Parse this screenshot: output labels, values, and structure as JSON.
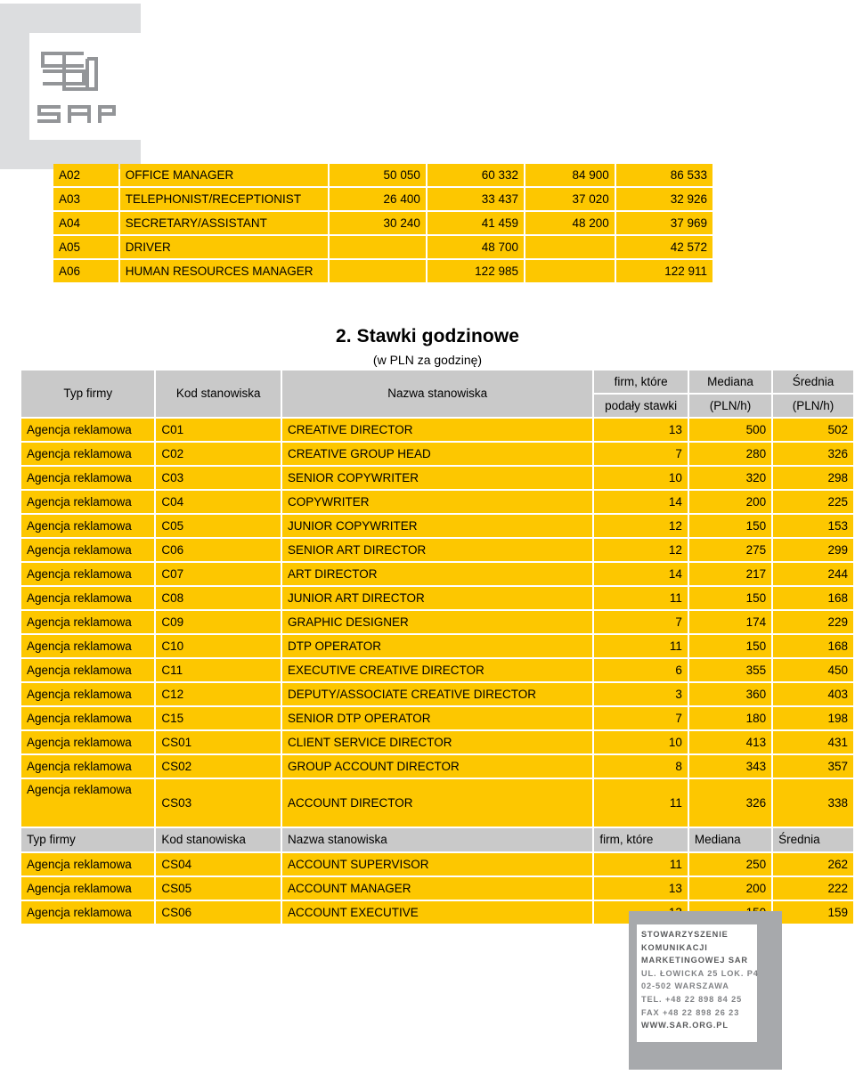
{
  "logo": {
    "brand": "SAR",
    "mark_name": "sar-logo-mark"
  },
  "top_table": {
    "rows": [
      {
        "code": "A02",
        "name": "OFFICE MANAGER",
        "v1": "50 050",
        "v2": "60 332",
        "v3": "84 900",
        "v4": "86 533"
      },
      {
        "code": "A03",
        "name": "TELEPHONIST/RECEPTIONIST",
        "v1": "26 400",
        "v2": "33 437",
        "v3": "37 020",
        "v4": "32 926"
      },
      {
        "code": "A04",
        "name": "SECRETARY/ASSISTANT",
        "v1": "30 240",
        "v2": "41 459",
        "v3": "48 200",
        "v4": "37 969"
      },
      {
        "code": "A05",
        "name": "DRIVER",
        "v1": "",
        "v2": "48 700",
        "v3": "",
        "v4": "42 572"
      },
      {
        "code": "A06",
        "name": "HUMAN RESOURCES MANAGER",
        "v1": "",
        "v2": "122 985",
        "v3": "",
        "v4": "122 911"
      }
    ]
  },
  "section": {
    "title": "2. Stawki godzinowe",
    "subtitle": "(w PLN za godzinę)"
  },
  "main_table": {
    "headers": {
      "typ": "Typ firmy",
      "kod": "Kod stanowiska",
      "nazwa": "Nazwa stanowiska",
      "firm_line1": "firm, które",
      "firm_line2": "podały stawki",
      "mediana_line1": "Mediana",
      "mediana_line2": "(PLN/h)",
      "srednia_line1": "Średnia",
      "srednia_line2": "(PLN/h)"
    },
    "headers_repeat": {
      "typ": "Typ firmy",
      "kod": "Kod stanowiska",
      "nazwa": "Nazwa stanowiska",
      "firm": "firm, które",
      "mediana": "Mediana",
      "srednia": "Średnia"
    },
    "rows": [
      {
        "typ": "Agencja reklamowa",
        "kod": "C01",
        "nazwa": "CREATIVE DIRECTOR",
        "firm": "13",
        "mediana": "500",
        "srednia": "502"
      },
      {
        "typ": "Agencja reklamowa",
        "kod": "C02",
        "nazwa": "CREATIVE GROUP HEAD",
        "firm": "7",
        "mediana": "280",
        "srednia": "326"
      },
      {
        "typ": "Agencja reklamowa",
        "kod": "C03",
        "nazwa": "SENIOR COPYWRITER",
        "firm": "10",
        "mediana": "320",
        "srednia": "298"
      },
      {
        "typ": "Agencja reklamowa",
        "kod": "C04",
        "nazwa": "COPYWRITER",
        "firm": "14",
        "mediana": "200",
        "srednia": "225"
      },
      {
        "typ": "Agencja reklamowa",
        "kod": "C05",
        "nazwa": "JUNIOR COPYWRITER",
        "firm": "12",
        "mediana": "150",
        "srednia": "153"
      },
      {
        "typ": "Agencja reklamowa",
        "kod": "C06",
        "nazwa": "SENIOR ART DIRECTOR",
        "firm": "12",
        "mediana": "275",
        "srednia": "299"
      },
      {
        "typ": "Agencja reklamowa",
        "kod": "C07",
        "nazwa": "ART DIRECTOR",
        "firm": "14",
        "mediana": "217",
        "srednia": "244"
      },
      {
        "typ": "Agencja reklamowa",
        "kod": "C08",
        "nazwa": "JUNIOR ART DIRECTOR",
        "firm": "11",
        "mediana": "150",
        "srednia": "168"
      },
      {
        "typ": "Agencja reklamowa",
        "kod": "C09",
        "nazwa": "GRAPHIC DESIGNER",
        "firm": "7",
        "mediana": "174",
        "srednia": "229"
      },
      {
        "typ": "Agencja reklamowa",
        "kod": "C10",
        "nazwa": "DTP OPERATOR",
        "firm": "11",
        "mediana": "150",
        "srednia": "168"
      },
      {
        "typ": "Agencja reklamowa",
        "kod": "C11",
        "nazwa": "EXECUTIVE CREATIVE DIRECTOR",
        "firm": "6",
        "mediana": "355",
        "srednia": "450"
      },
      {
        "typ": "Agencja reklamowa",
        "kod": "C12",
        "nazwa": "DEPUTY/ASSOCIATE CREATIVE DIRECTOR",
        "firm": "3",
        "mediana": "360",
        "srednia": "403"
      },
      {
        "typ": "Agencja reklamowa",
        "kod": "C15",
        "nazwa": "SENIOR DTP OPERATOR",
        "firm": "7",
        "mediana": "180",
        "srednia": "198"
      },
      {
        "typ": "Agencja reklamowa",
        "kod": "CS01",
        "nazwa": "CLIENT SERVICE DIRECTOR",
        "firm": "10",
        "mediana": "413",
        "srednia": "431"
      },
      {
        "typ": "Agencja reklamowa",
        "kod": "CS02",
        "nazwa": "GROUP ACCOUNT DIRECTOR",
        "firm": "8",
        "mediana": "343",
        "srednia": "357"
      },
      {
        "typ": "Agencja reklamowa",
        "kod": "CS03",
        "nazwa": "ACCOUNT DIRECTOR",
        "firm": "11",
        "mediana": "326",
        "srednia": "338",
        "tall": true
      }
    ],
    "rows_after_repeat": [
      {
        "typ": "Agencja reklamowa",
        "kod": "CS04",
        "nazwa": "ACCOUNT SUPERVISOR",
        "firm": "11",
        "mediana": "250",
        "srednia": "262"
      },
      {
        "typ": "Agencja reklamowa",
        "kod": "CS05",
        "nazwa": "ACCOUNT MANAGER",
        "firm": "13",
        "mediana": "200",
        "srednia": "222"
      },
      {
        "typ": "Agencja reklamowa",
        "kod": "CS06",
        "nazwa": "ACCOUNT EXECUTIVE",
        "firm": "13",
        "mediana": "150",
        "srednia": "159"
      }
    ]
  },
  "footer": {
    "lines": [
      "STOWARZYSZENIE",
      "KOMUNIKACJI",
      "MARKETINGOWEJ SAR",
      "UL. ŁOWICKA 25 LOK. P4",
      "02-502 WARSZAWA",
      "TEL. +48 22 898 84 25",
      "FAX +48 22 898 26 23",
      "WWW.SAR.ORG.PL"
    ]
  },
  "colors": {
    "highlight": "#fdc700",
    "header_gray": "#c9c9c9",
    "logo_gray": "#dcdddf",
    "footer_gray": "#a7a9ac"
  }
}
